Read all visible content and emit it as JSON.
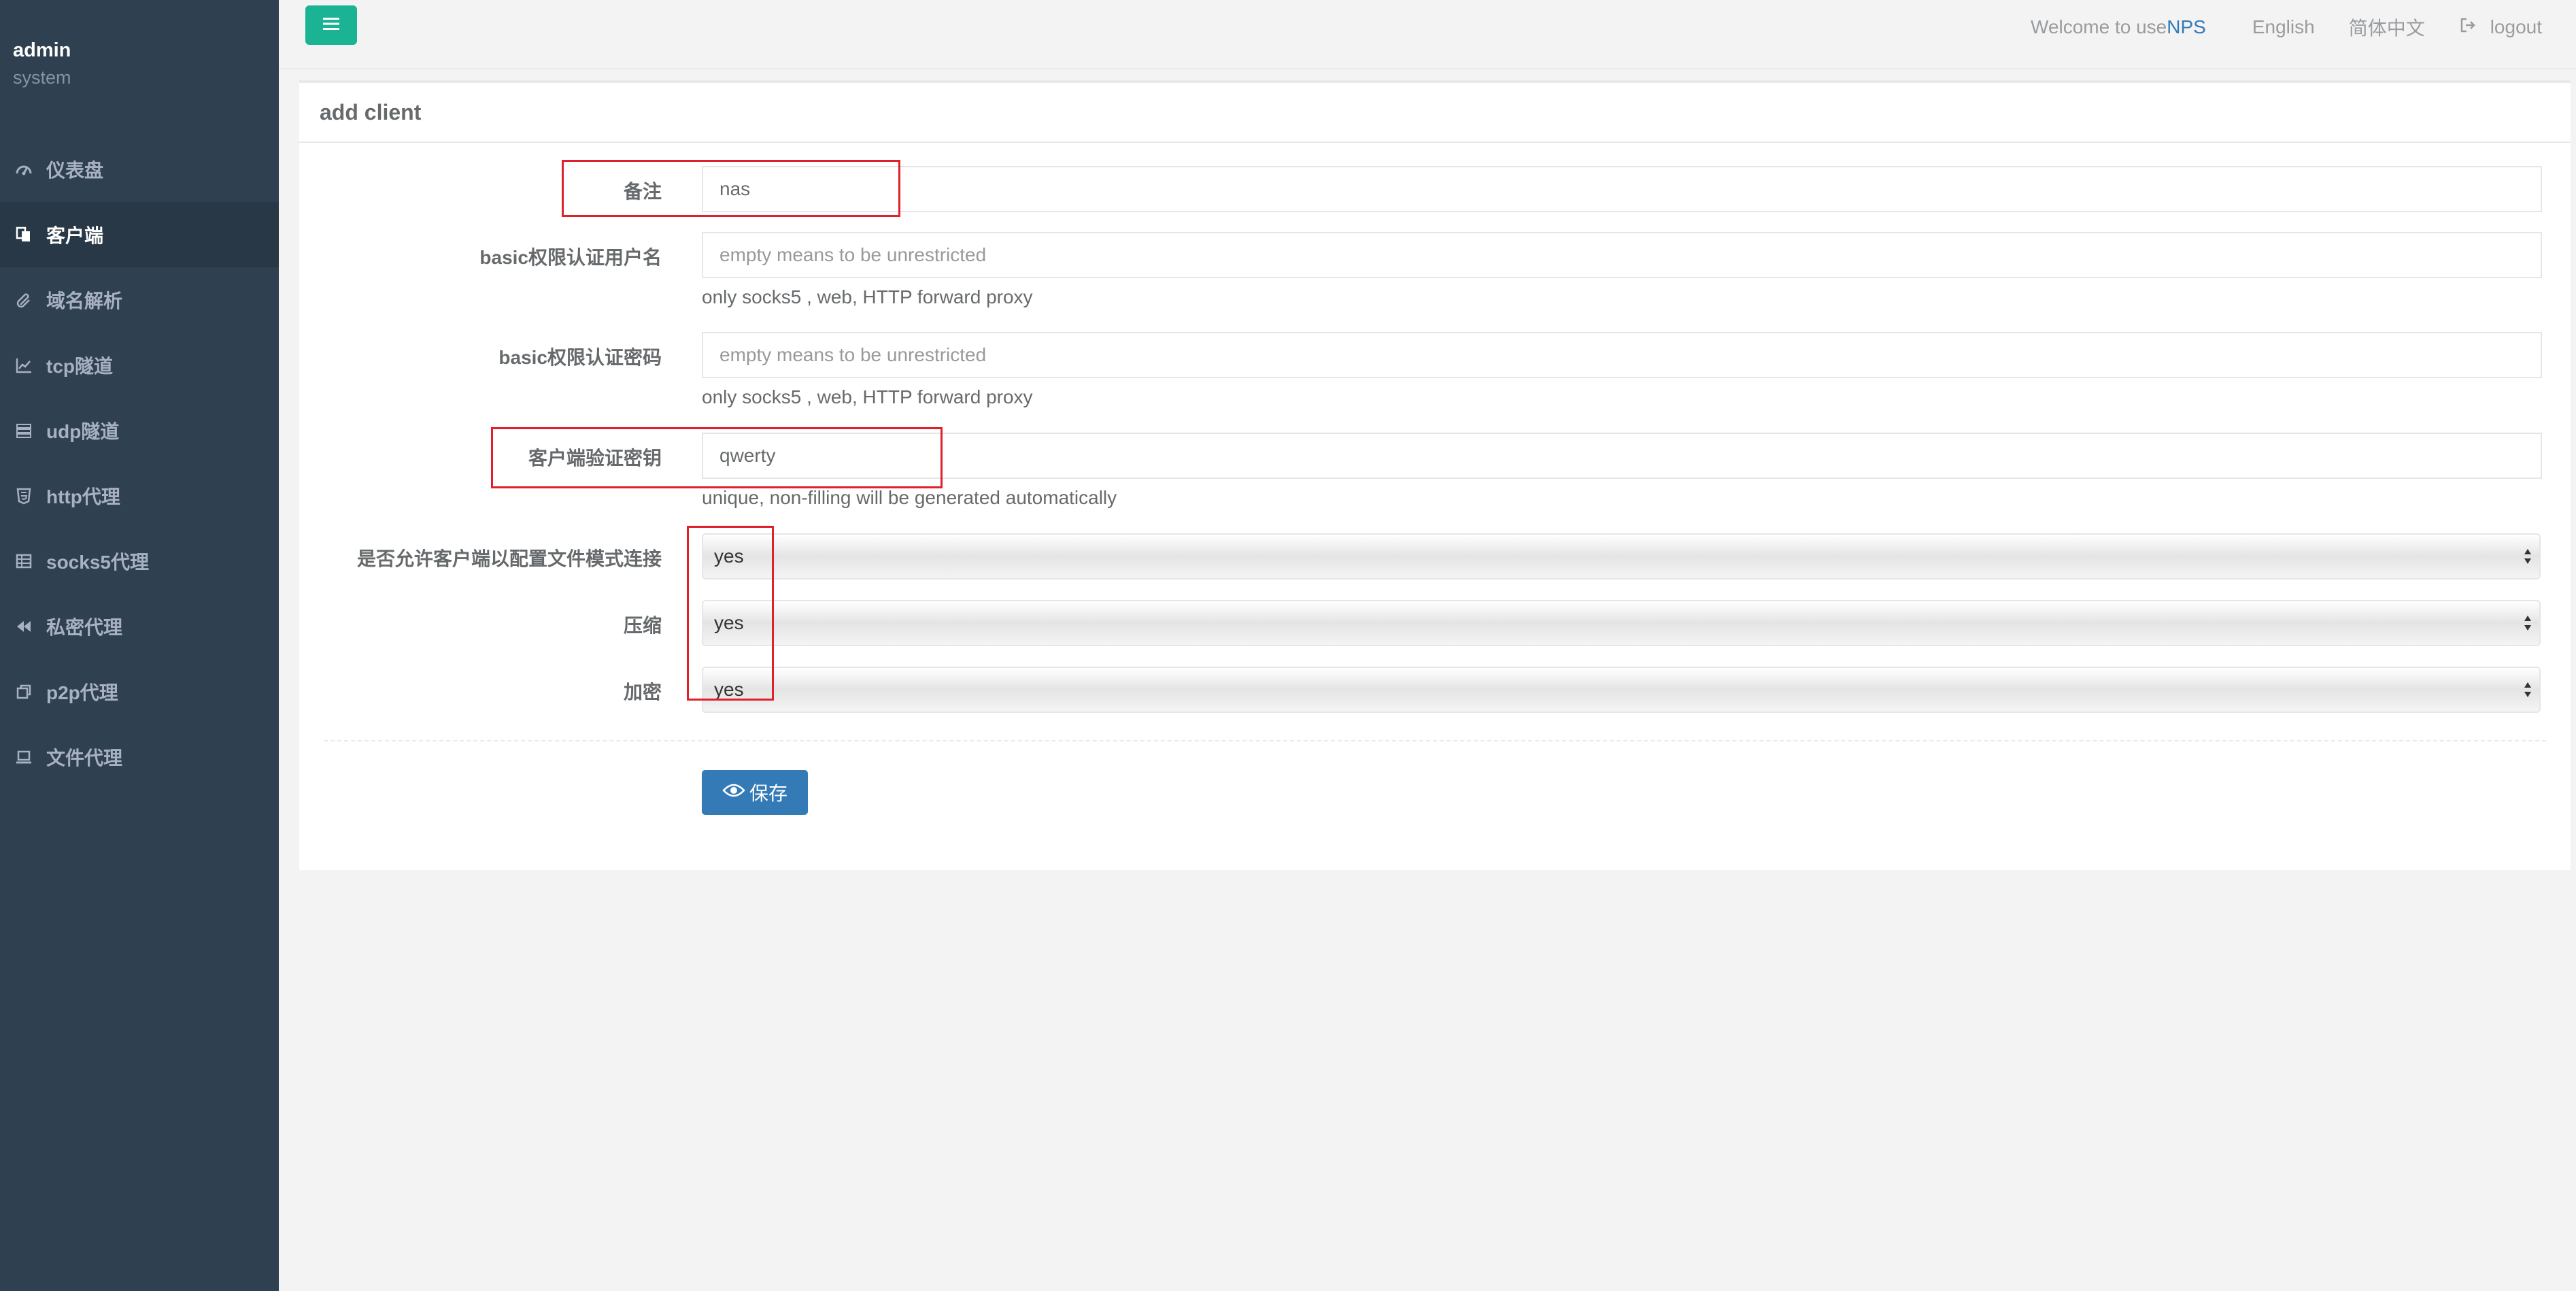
{
  "user": {
    "name": "admin",
    "role": "system"
  },
  "sidebar": {
    "items": [
      {
        "label": "仪表盘",
        "icon": "dashboard-icon",
        "active": false
      },
      {
        "label": "客户端",
        "icon": "copy-icon",
        "active": true
      },
      {
        "label": "域名解析",
        "icon": "paperclip-icon",
        "active": false
      },
      {
        "label": "tcp隧道",
        "icon": "line-chart-icon",
        "active": false
      },
      {
        "label": "udp隧道",
        "icon": "server-icon",
        "active": false
      },
      {
        "label": "http代理",
        "icon": "html5-icon",
        "active": false
      },
      {
        "label": "socks5代理",
        "icon": "table-icon",
        "active": false
      },
      {
        "label": "私密代理",
        "icon": "backward-icon",
        "active": false
      },
      {
        "label": "p2p代理",
        "icon": "clone-icon",
        "active": false
      },
      {
        "label": "文件代理",
        "icon": "laptop-icon",
        "active": false
      }
    ]
  },
  "header": {
    "welcome": "Welcome to use",
    "brand": "NPS",
    "lang_en": "English",
    "lang_zh": "简体中文",
    "logout": "logout"
  },
  "panel": {
    "title": "add client",
    "fields": {
      "remark": {
        "label": "备注",
        "value": "nas"
      },
      "basic_user": {
        "label": "basic权限认证用户名",
        "placeholder": "empty means to be unrestricted",
        "help": "only socks5 , web, HTTP forward proxy"
      },
      "basic_pass": {
        "label": "basic权限认证密码",
        "placeholder": "empty means to be unrestricted",
        "help": "only socks5 , web, HTTP forward proxy"
      },
      "vkey": {
        "label": "客户端验证密钥",
        "value": "qwerty",
        "help": "unique, non-filling will be generated automatically"
      },
      "config_conn": {
        "label": "是否允许客户端以配置文件模式连接",
        "value": "yes"
      },
      "compress": {
        "label": "压缩",
        "value": "yes"
      },
      "crypt": {
        "label": "加密",
        "value": "yes"
      }
    },
    "save_label": "保存"
  },
  "colors": {
    "sidebar_bg": "#2f4050",
    "accent_green": "#1ab394",
    "primary_blue": "#337ab7",
    "highlight_red": "#e0202a"
  }
}
